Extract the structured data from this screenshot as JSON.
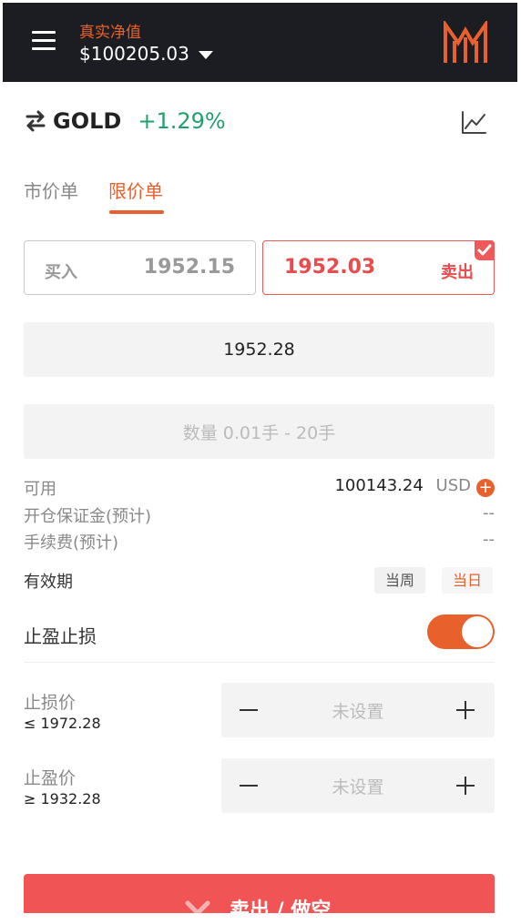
{
  "header": {
    "account_label": "真实净值",
    "account_value": "$100205.03",
    "menu_icon": "hamburger-icon",
    "logo_icon": "brand-m-logo"
  },
  "symbol": {
    "name": "GOLD",
    "change": "+1.29%",
    "change_color": "#22a06b",
    "swap_icon": "swap-arrows-icon",
    "chart_icon": "line-chart-icon"
  },
  "tabs": [
    {
      "label": "市价单",
      "active": false
    },
    {
      "label": "限价单",
      "active": true
    }
  ],
  "quote": {
    "buy_label": "买入",
    "buy_price": "1952.15",
    "sell_price": "1952.03",
    "sell_label": "卖出",
    "selected": "sell"
  },
  "order": {
    "price_value": "1952.28",
    "quantity_placeholder": "数量 0.01手 - 20手"
  },
  "info": {
    "available_label": "可用",
    "available_value": "100143.24",
    "available_unit": "USD",
    "margin_label": "开仓保证金(预计)",
    "margin_value": "--",
    "fee_label": "手续费(预计)",
    "fee_value": "--"
  },
  "validity": {
    "label": "有效期",
    "options": [
      "当周",
      "当日"
    ],
    "selected": "当日"
  },
  "sltp": {
    "label": "止盈止损",
    "enabled": true,
    "stop_loss": {
      "label": "止损价",
      "limit": "≤ 1972.28",
      "value": "未设置"
    },
    "take_profit": {
      "label": "止盈价",
      "limit": "≥ 1932.28",
      "value": "未设置"
    }
  },
  "submit": {
    "label": "卖出 / 做空",
    "color": "#f05454"
  },
  "colors": {
    "accent": "#e8612c",
    "sell": "#e84c4c",
    "header_bg": "#1c1d22"
  }
}
